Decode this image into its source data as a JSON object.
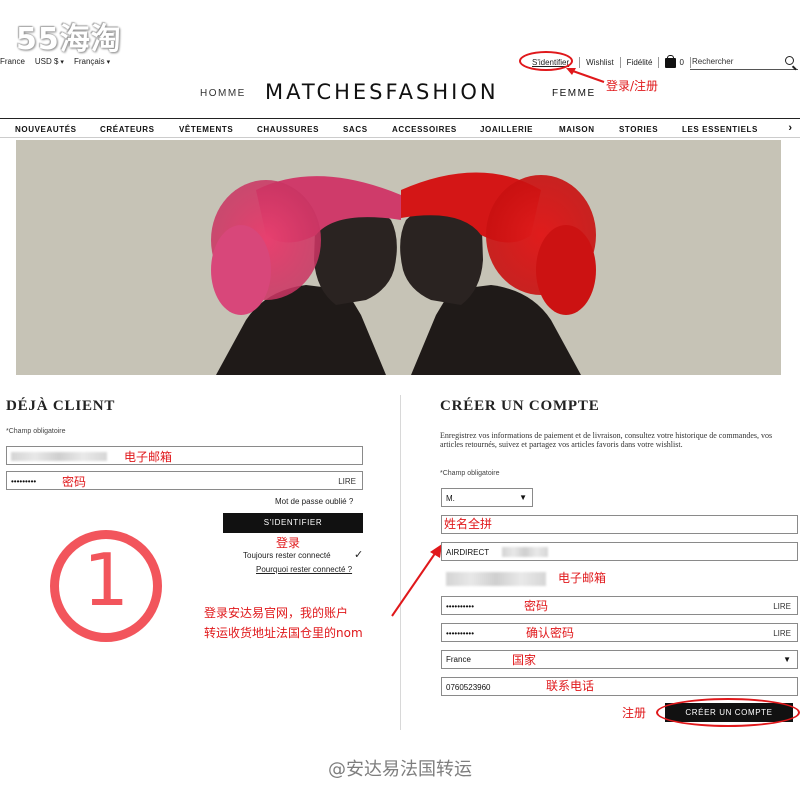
{
  "watermark": {
    "logo": "55海淘",
    "footer": "@安达易法国转运"
  },
  "util_bar": {
    "country": "France",
    "currency": "USD $",
    "language": "Français",
    "signin": "S'identifier",
    "wishlist": "Wishlist",
    "loyalty": "Fidélité",
    "bag_count": "0",
    "search_placeholder": "Rechercher"
  },
  "brand_row": {
    "homme": "HOMME",
    "brand": "MATCHESFASHION",
    "femme": "FEMME"
  },
  "nav": [
    "NOUVEAUTÉS",
    "CRÉATEURS",
    "VÊTEMENTS",
    "CHAUSSURES",
    "SACS",
    "ACCESSOIRES",
    "JOAILLERIE",
    "MAISON",
    "STORIES",
    "LES ESSENTIELS"
  ],
  "login": {
    "title": "DÉJÀ CLIENT",
    "required": "*Champ obligatoire",
    "email_note": "电子邮箱",
    "password_value": "•••••••••",
    "password_note": "密码",
    "lire": "LIRE",
    "forgot": "Mot de passe oublié ?",
    "submit": "S'IDENTIFIER",
    "submit_note": "登录",
    "stay_connected": "Toujours rester connecté",
    "checkmark": "✓",
    "why": "Pourquoi rester connecté ?"
  },
  "register": {
    "title": "CRÉER UN COMPTE",
    "intro": "Enregistrez vos informations de paiement et de livraison, consultez votre historique de commandes, vos articles retournés, suivez et partagez vos articles favoris dans votre wishlist.",
    "required": "*Champ obligatoire",
    "civility": "M.",
    "name_note": "姓名全拼",
    "name_value": "AIRDIRECT",
    "email_note": "电子邮箱",
    "password_value": "••••••••••",
    "password_note": "密码",
    "confirm_value": "••••••••••",
    "confirm_note": "确认密码",
    "lire": "LIRE",
    "country": "France",
    "country_note": "国家",
    "phone": "0760523960",
    "phone_note": "联系电话",
    "submit": "CRÉER UN COMPTE",
    "submit_note": "注册"
  },
  "annotations": {
    "signin_note": "登录/注册",
    "step": "①",
    "guide_line1": "登录安达易官网，我的账户",
    "guide_line2": "转运收货地址法国仓里的nom"
  },
  "colors": {
    "annotation_red": "#e0181b",
    "step_pink": "#f2555c",
    "button_black": "#111111",
    "hero_bg": "#c6c3b6"
  }
}
